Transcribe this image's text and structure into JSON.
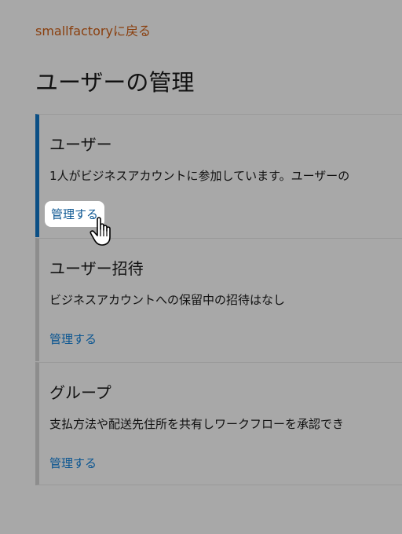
{
  "nav": {
    "back_label": "smallfactoryに戻る"
  },
  "page": {
    "title": "ユーザーの管理"
  },
  "sections": [
    {
      "title": "ユーザー",
      "description": "1人がビジネスアカウントに参加しています。ユーザーの",
      "link": "管理する"
    },
    {
      "title": "ユーザー招待",
      "description": "ビジネスアカウントへの保留中の招待はなし",
      "link": "管理する"
    },
    {
      "title": "グループ",
      "description": "支払方法や配送先住所を共有しワークフローを承認でき",
      "link": "管理する"
    }
  ],
  "colors": {
    "back_link": "#8a3f0e",
    "link": "#0a5591",
    "active_accent": "#0b4f85",
    "inactive_accent": "#8d8d8d",
    "background": "#a8a8a8"
  },
  "icons": {
    "cursor": "hand-pointer-icon"
  }
}
